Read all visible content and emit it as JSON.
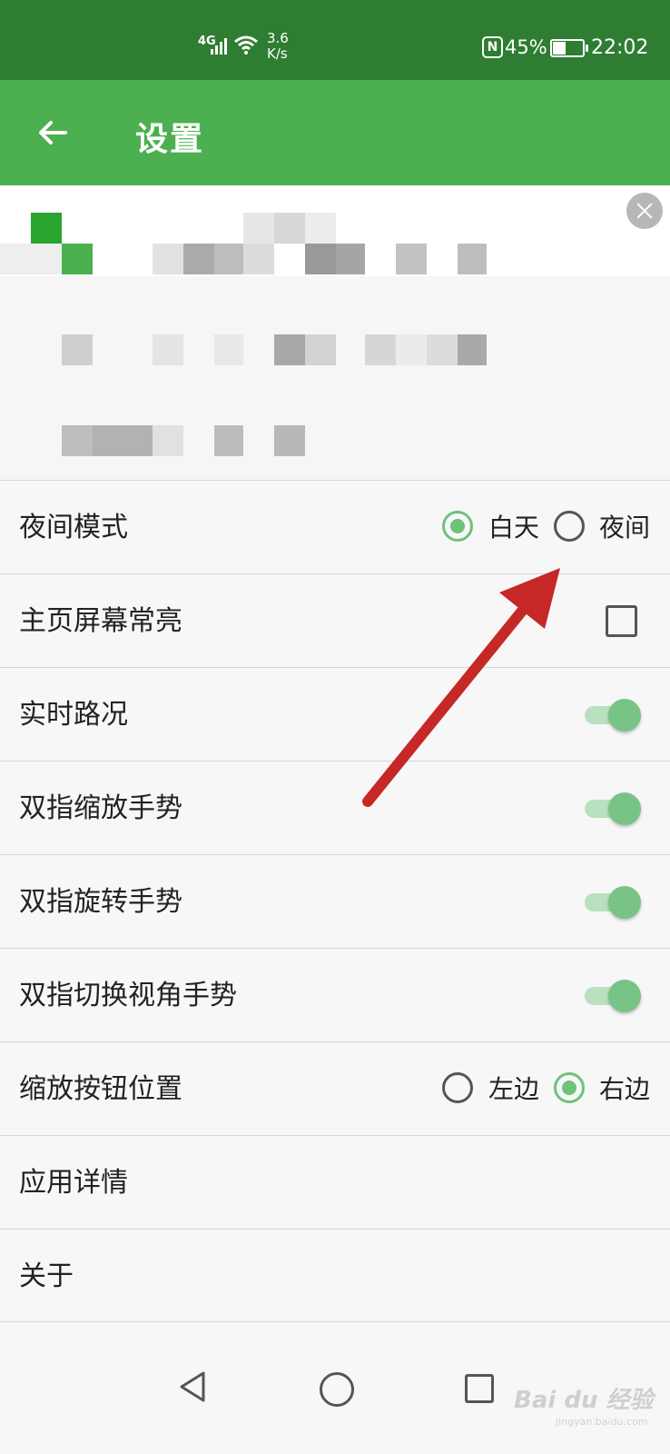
{
  "status_bar": {
    "network": "4G",
    "speed_value": "3.6",
    "speed_unit": "K/s",
    "nfc": "N",
    "battery": "45%",
    "time": "22:02"
  },
  "app_bar": {
    "title": "设置"
  },
  "settings": {
    "night_mode": {
      "label": "夜间模式",
      "options": [
        "白天",
        "夜间"
      ],
      "selected": "白天"
    },
    "keep_screen_on": {
      "label": "主页屏幕常亮",
      "checked": false
    },
    "traffic": {
      "label": "实时路况",
      "on": true
    },
    "pinch_zoom": {
      "label": "双指缩放手势",
      "on": true
    },
    "rotate": {
      "label": "双指旋转手势",
      "on": true
    },
    "tilt": {
      "label": "双指切换视角手势",
      "on": true
    },
    "zoom_button_position": {
      "label": "缩放按钮位置",
      "options": [
        "左边",
        "右边"
      ],
      "selected": "右边"
    },
    "app_details": {
      "label": "应用详情"
    },
    "about": {
      "label": "关于"
    }
  },
  "watermark": {
    "main": "Bai du 经验",
    "sub": "jingyan.baidu.com"
  },
  "colors": {
    "status_bar": "#2e7d32",
    "app_bar": "#4caf50",
    "accent": "#6ec27a",
    "arrow": "#c62828"
  }
}
